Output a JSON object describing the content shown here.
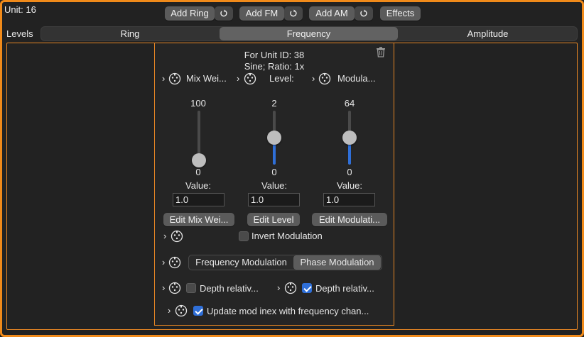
{
  "header": {
    "unit_label": "Unit: 16",
    "buttons": {
      "add_ring": "Add Ring",
      "add_fm": "Add FM",
      "add_am": "Add AM",
      "effects": "Effects"
    }
  },
  "levels_label": "Levels",
  "tabs": [
    {
      "label": "Ring",
      "selected": false
    },
    {
      "label": "Frequency",
      "selected": true
    },
    {
      "label": "Amplitude",
      "selected": false
    }
  ],
  "panel": {
    "unit_id_line": "For Unit ID:  38",
    "wave_line": "Sine; Ratio: 1x",
    "sliders": [
      {
        "header": "Mix Wei...",
        "max_label": "100",
        "min_label": "0",
        "value_label": "Value:",
        "value": "1.0",
        "level": 0.0,
        "edit_button": "Edit Mix Wei..."
      },
      {
        "header": "Level:",
        "max_label": "2",
        "min_label": "0",
        "value_label": "Value:",
        "value": "1.0",
        "level": 0.5,
        "edit_button": "Edit Level"
      },
      {
        "header": "Modula...",
        "max_label": "64",
        "min_label": "0",
        "value_label": "Value:",
        "value": "1.0",
        "level": 0.5,
        "edit_button": "Edit Modulati..."
      }
    ],
    "invert_modulation": {
      "label": "Invert Modulation",
      "checked": false
    },
    "modulation_type": {
      "options": [
        "Frequency Modulation",
        "Phase Modulation"
      ],
      "selected": "Phase Modulation"
    },
    "depth_left": {
      "label": "Depth relativ...",
      "checked": false
    },
    "depth_right": {
      "label": "Depth relativ...",
      "checked": true
    },
    "update_mod_index": {
      "label": "Update mod inex with frequency chan...",
      "checked": true
    }
  },
  "colors": {
    "accent_border": "#f08a1a",
    "checkbox_blue": "#2f6fd8",
    "background": "#222222"
  },
  "icons": [
    "refresh-icon",
    "connector-icon",
    "chevron-right-icon",
    "trash-icon"
  ]
}
